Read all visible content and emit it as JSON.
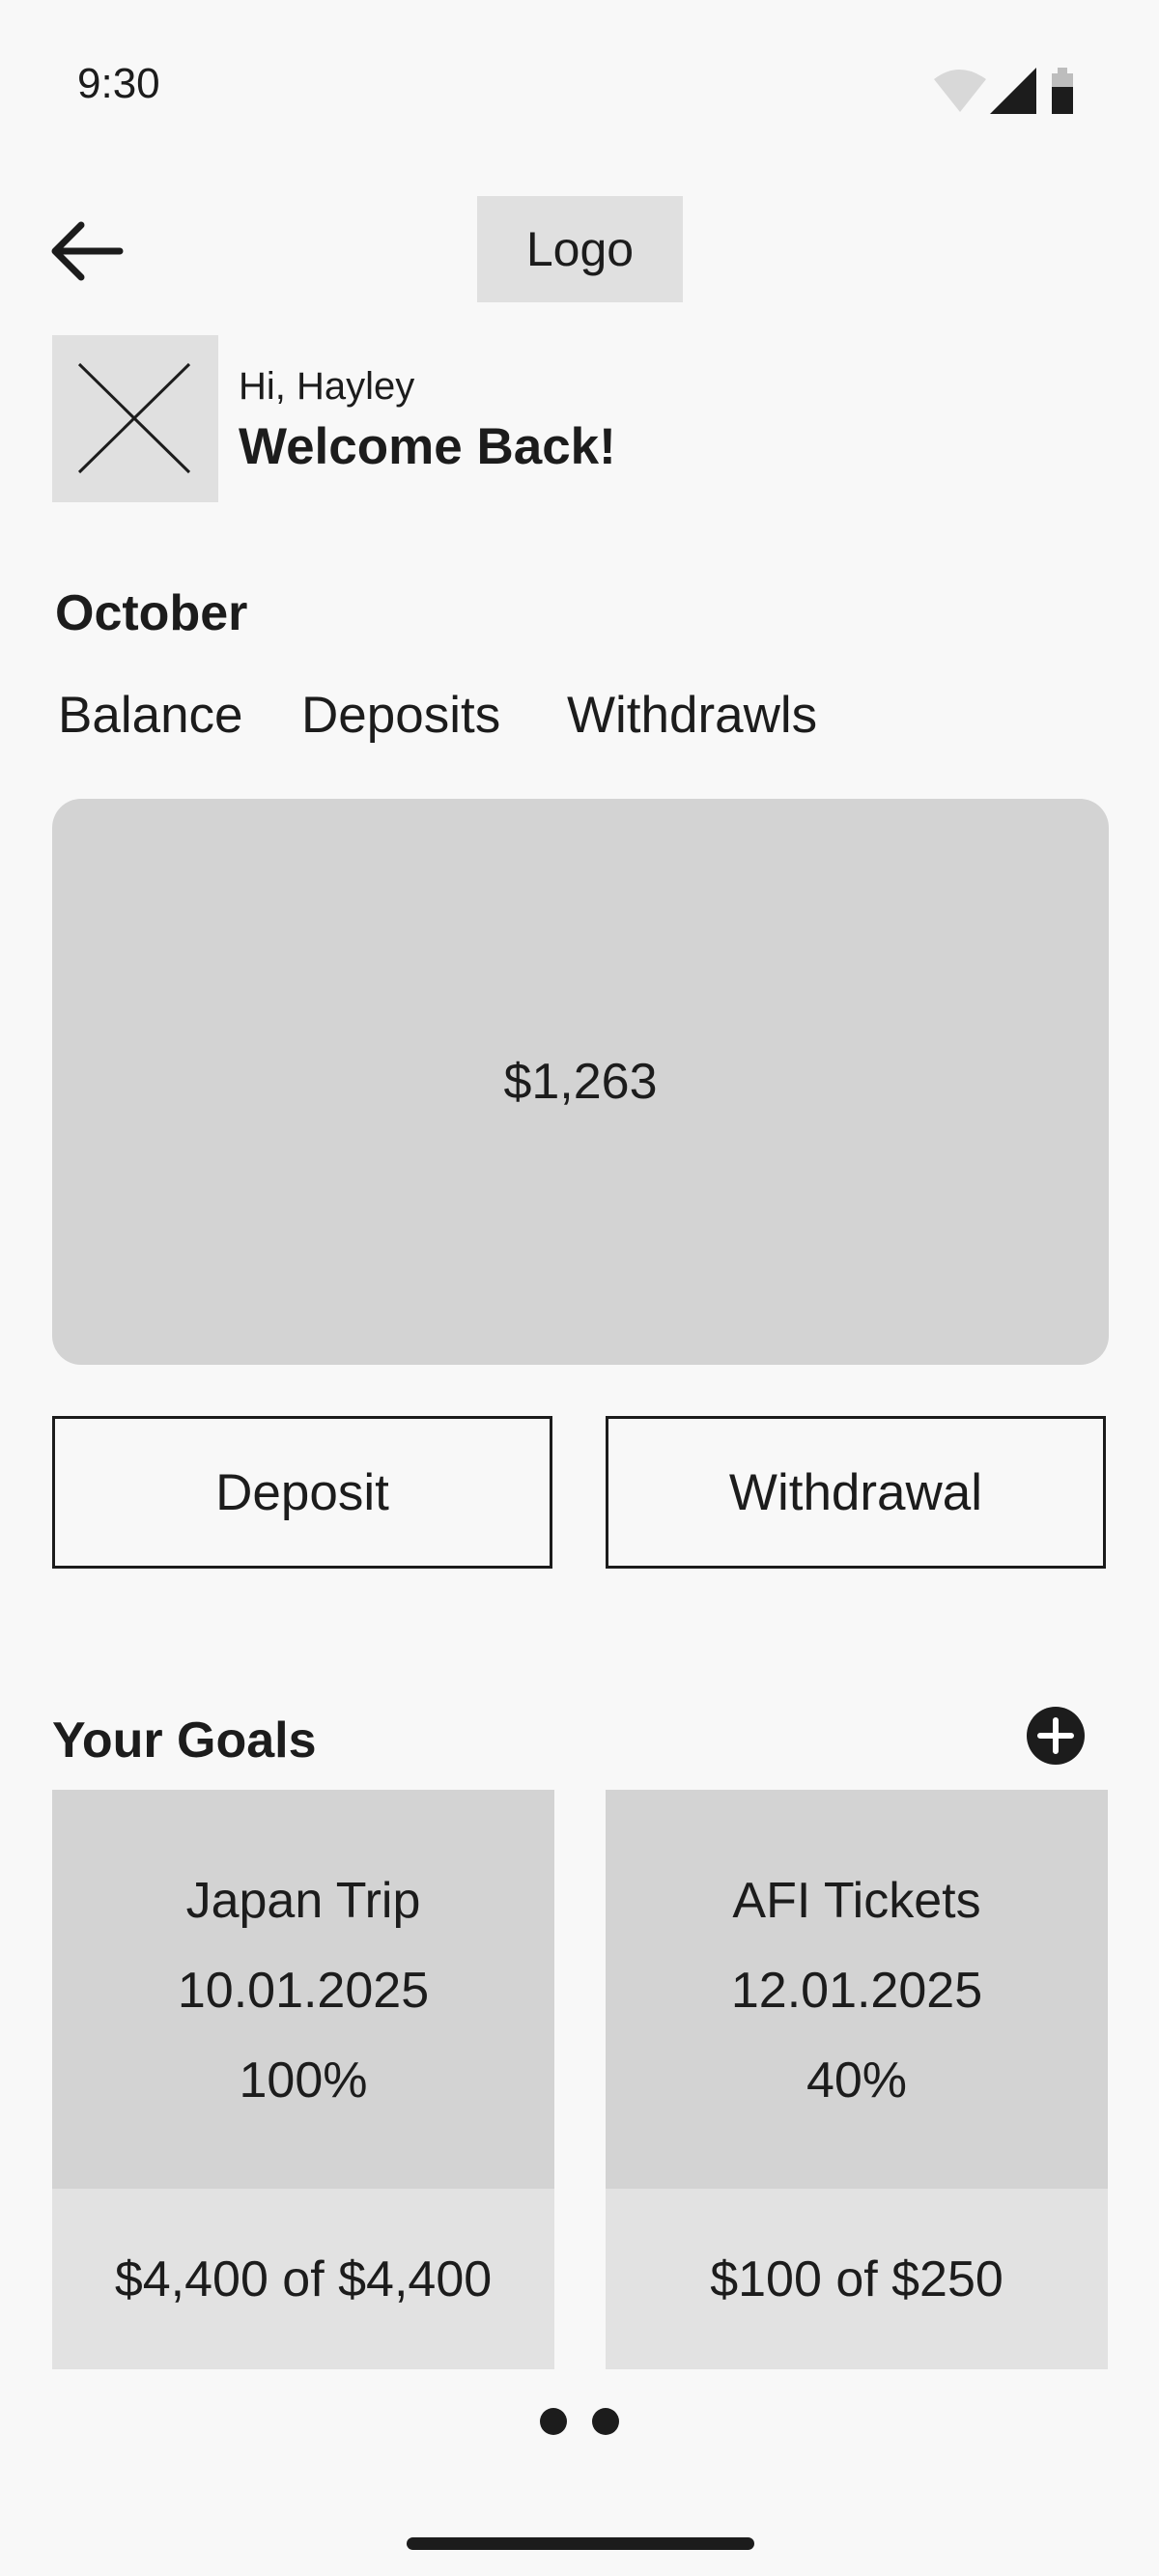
{
  "status_bar": {
    "time": "9:30",
    "icons": [
      "wifi-icon",
      "signal-icon",
      "battery-icon"
    ]
  },
  "header": {
    "back_icon": "arrow-left-icon",
    "logo_label": "Logo"
  },
  "greeting": {
    "avatar_icon": "image-placeholder-icon",
    "small": "Hi, Hayley",
    "big": "Welcome Back!"
  },
  "summary": {
    "month": "October",
    "tabs": [
      {
        "label": "Balance"
      },
      {
        "label": "Deposits"
      },
      {
        "label": "Withdrawls"
      }
    ],
    "balance": "$1,263"
  },
  "actions": {
    "deposit_label": "Deposit",
    "withdrawal_label": "Withdrawal"
  },
  "goals": {
    "title": "Your Goals",
    "add_icon": "plus-circle-icon",
    "items": [
      {
        "name": "Japan Trip",
        "date": "10.01.2025",
        "percent": "100%",
        "amount": "$4,400 of $4,400"
      },
      {
        "name": "AFI Tickets",
        "date": "12.01.2025",
        "percent": "40%",
        "amount": "$100 of $250"
      }
    ],
    "pager_dots": 2
  },
  "colors": {
    "background": "#f8f8f8",
    "card": "#d3d3d3",
    "card_light": "#e2e2e2",
    "text": "#1c1c1c"
  }
}
